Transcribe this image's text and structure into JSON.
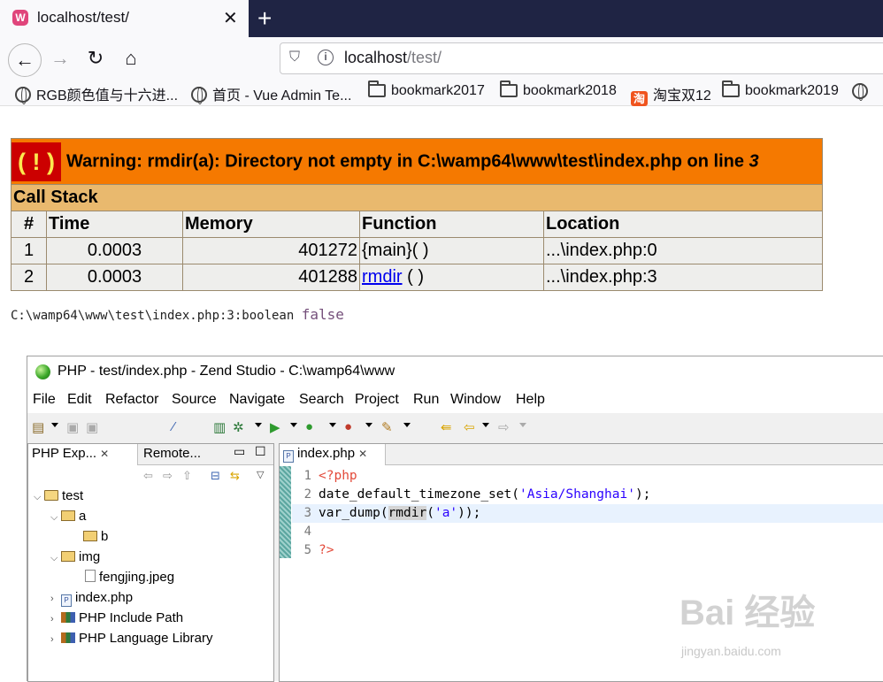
{
  "browser": {
    "tab_title": "localhost/test/",
    "tab_favicon": "W",
    "url_host": "localhost",
    "url_path": "/test/",
    "bookmarks": [
      {
        "label": "RGB颜色值与十六进...",
        "icon": "globe-icon"
      },
      {
        "label": "首页 - Vue Admin Te...",
        "icon": "globe-icon"
      },
      {
        "label": "bookmark2017",
        "icon": "folder-icon"
      },
      {
        "label": "bookmark2018",
        "icon": "folder-icon"
      },
      {
        "label": "淘宝双12",
        "icon": "taobao-icon"
      },
      {
        "label": "bookmark2019",
        "icon": "folder-icon"
      }
    ]
  },
  "xdebug": {
    "badge": "( ! )",
    "warning": "Warning: rmdir(a): Directory not empty in C:\\wamp64\\www\\test\\index.php on line",
    "warning_line": "3",
    "call_stack_title": "Call Stack",
    "columns": [
      "#",
      "Time",
      "Memory",
      "Function",
      "Location"
    ],
    "rows": [
      {
        "idx": "1",
        "time": "0.0003",
        "memory": "401272",
        "function": "{main}( )",
        "function_link": "",
        "location": "...\\index.php:0"
      },
      {
        "idx": "2",
        "time": "0.0003",
        "memory": "401288",
        "function": " ( )",
        "function_link": "rmdir",
        "location": "...\\index.php:3"
      }
    ],
    "var_dump_prefix": "C:\\wamp64\\www\\test\\index.php:3:boolean",
    "var_dump_value": "false"
  },
  "ide": {
    "title": "PHP - test/index.php - Zend Studio - C:\\wamp64\\www",
    "menus": [
      "File",
      "Edit",
      "Refactor",
      "Source",
      "Navigate",
      "Search",
      "Project",
      "Run",
      "Window",
      "Help"
    ],
    "explorer_tab": "PHP Exp...",
    "remote_tab": "Remote...",
    "tree": [
      {
        "label": "test",
        "icon": "project-icon",
        "expanded": true
      },
      {
        "label": "a",
        "icon": "package-icon",
        "expanded": true
      },
      {
        "label": "b",
        "icon": "package-icon"
      },
      {
        "label": "img",
        "icon": "package-icon",
        "expanded": true
      },
      {
        "label": "fengjing.jpeg",
        "icon": "image-file-icon"
      },
      {
        "label": "index.php",
        "icon": "php-file-icon"
      },
      {
        "label": "PHP Include Path",
        "icon": "library-icon"
      },
      {
        "label": "PHP Language Library",
        "icon": "library-icon"
      }
    ],
    "editor_tab": "index.php",
    "line_numbers": [
      "1",
      "2",
      "3",
      "4",
      "5"
    ],
    "code": {
      "l1": "<?php",
      "l2_fn": "date_default_timezone_set(",
      "l2_str": "'Asia/Shanghai'",
      "l2_end": ");",
      "l3_fn": "var_dump(",
      "l3_sel": "rmdir",
      "l3_mid": "(",
      "l3_str": "'a'",
      "l3_end": "));",
      "l5": "?>"
    }
  },
  "watermark": {
    "main": "Bai 经验",
    "sub": "jingyan.baidu.com"
  }
}
